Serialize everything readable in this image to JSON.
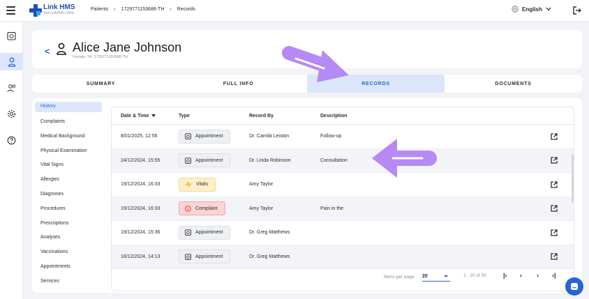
{
  "brand": {
    "name": "Link HMS",
    "subtitle": "Test LinkHMS Clinic"
  },
  "breadcrumb": [
    "Patients",
    "1729771153686-TH",
    "Records"
  ],
  "language": "English",
  "patient": {
    "name": "Alice Jane Johnson",
    "subtitle": "Female, 54, 1729771153686-TH"
  },
  "tabs": [
    {
      "label": "SUMMARY"
    },
    {
      "label": "FULL INFO"
    },
    {
      "label": "RECORDS"
    },
    {
      "label": "DOCUMENTS"
    }
  ],
  "menu": [
    "History",
    "Complaints",
    "Medical Background",
    "Physical Examination",
    "Vital Signs",
    "Allergies",
    "Diagnoses",
    "Procedures",
    "Prescriptions",
    "Analyses",
    "Vaccinations",
    "Appointments",
    "Services"
  ],
  "table": {
    "headers": {
      "date": "Date & Time",
      "type": "Type",
      "record_by": "Record By",
      "description": "Description"
    },
    "rows": [
      {
        "date": "8/01/2025, 12:56",
        "type": "Appointment",
        "record_by": "Dr. Camila Leiston",
        "description": "Follow-up"
      },
      {
        "date": "24/12/2024, 15:55",
        "type": "Appointment",
        "record_by": "Dr. Linda Robinson",
        "description": "Consultation"
      },
      {
        "date": "19/12/2024, 16:33",
        "type": "Vitals",
        "record_by": "Amy Taylor",
        "description": ""
      },
      {
        "date": "19/12/2024, 16:33",
        "type": "Complaint",
        "record_by": "Amy Taylor",
        "description": "Pain in the"
      },
      {
        "date": "19/12/2024, 15:36",
        "type": "Appointment",
        "record_by": "Dr. Greg Matthews",
        "description": ""
      },
      {
        "date": "18/12/2024, 14:13",
        "type": "Appointment",
        "record_by": "Dr. Greg Matthews",
        "description": ""
      }
    ]
  },
  "pager": {
    "items_label": "Items per page:",
    "page_size": "20",
    "range": "1 - 20 of 50"
  },
  "colors": {
    "accent": "#2563d9",
    "tab_active_bg": "#dbe6fb",
    "overlay_arrow": "#b68af5"
  }
}
